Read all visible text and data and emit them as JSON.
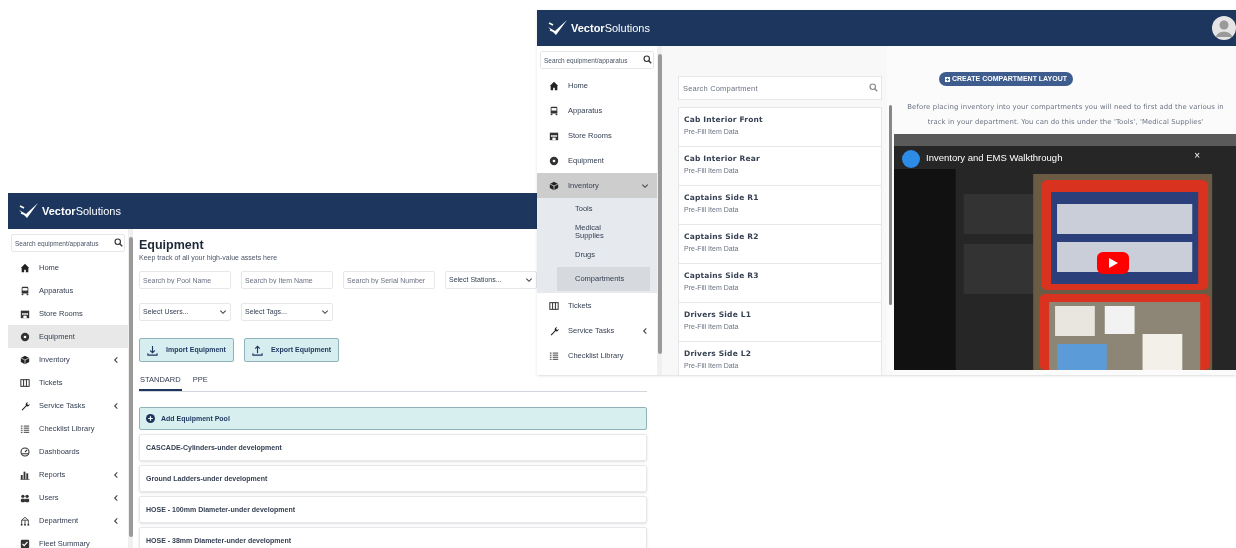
{
  "equipment_window": {
    "logo": {
      "bold": "Vector",
      "light": "Solutions"
    },
    "sidebar": {
      "search_placeholder": "Search equipment/apparatus",
      "items": [
        {
          "label": "Home",
          "kind": "link",
          "selected": false
        },
        {
          "label": "Apparatus",
          "kind": "link",
          "selected": false
        },
        {
          "label": "Store Rooms",
          "kind": "link",
          "selected": false
        },
        {
          "label": "Equipment",
          "kind": "link",
          "selected": true
        },
        {
          "label": "Inventory",
          "kind": "group",
          "selected": false,
          "expanded": false
        },
        {
          "label": "Tickets",
          "kind": "link",
          "selected": false
        },
        {
          "label": "Service Tasks",
          "kind": "group",
          "selected": false,
          "expanded": false
        },
        {
          "label": "Checklist Library",
          "kind": "link",
          "selected": false
        },
        {
          "label": "Dashboards",
          "kind": "link",
          "selected": false
        },
        {
          "label": "Reports",
          "kind": "group",
          "selected": false,
          "expanded": false
        },
        {
          "label": "Users",
          "kind": "group",
          "selected": false,
          "expanded": false
        },
        {
          "label": "Department",
          "kind": "group",
          "selected": false,
          "expanded": false
        },
        {
          "label": "Fleet Summary",
          "kind": "link",
          "selected": false
        }
      ]
    },
    "page": {
      "title": "Equipment",
      "subtitle": "Keep track of all your high-value assets here",
      "filters": [
        {
          "kind": "input",
          "placeholder": "Search by Pool Name"
        },
        {
          "kind": "input",
          "placeholder": "Search by Item Name"
        },
        {
          "kind": "input",
          "placeholder": "Search by Serial Number"
        },
        {
          "kind": "select",
          "placeholder": "Select Stations..."
        },
        {
          "kind": "select",
          "placeholder": "Select Users..."
        },
        {
          "kind": "select",
          "placeholder": "Select Tags..."
        }
      ],
      "actions": [
        {
          "label": "Import Equipment",
          "kind": "import"
        },
        {
          "label": "Export Equipment",
          "kind": "export"
        }
      ],
      "tabs": [
        {
          "label": "STANDARD",
          "selected": true
        },
        {
          "label": "PPE",
          "selected": false
        }
      ],
      "add_button": "Add Equipment Pool",
      "pools": [
        "CASCADE-Cylinders-under development",
        "Ground Ladders-under development",
        "HOSE - 100mm Diameter-under development",
        "HOSE - 38mm Diameter-under development"
      ]
    }
  },
  "compartment_window": {
    "logo": {
      "bold": "Vector",
      "light": "Solutions"
    },
    "sidebar": {
      "search_placeholder": "Search equipment/apparatus",
      "items": [
        {
          "label": "Home",
          "kind": "link",
          "selected": false
        },
        {
          "label": "Apparatus",
          "kind": "link",
          "selected": false
        },
        {
          "label": "Store Rooms",
          "kind": "link",
          "selected": false
        },
        {
          "label": "Equipment",
          "kind": "link",
          "selected": false
        },
        {
          "label": "Inventory",
          "kind": "group",
          "selected": false,
          "expanded": true,
          "children": [
            {
              "label": "Tools",
              "selected": false
            },
            {
              "label": "Medical Supplies",
              "selected": false
            },
            {
              "label": "Drugs",
              "selected": false
            },
            {
              "label": "Compartments",
              "selected": true
            }
          ]
        },
        {
          "label": "Tickets",
          "kind": "link",
          "selected": false
        },
        {
          "label": "Service Tasks",
          "kind": "group",
          "selected": false,
          "expanded": false
        },
        {
          "label": "Checklist Library",
          "kind": "link",
          "selected": false
        }
      ]
    },
    "compartment_search": {
      "placeholder": "Search Compartment"
    },
    "compartments": [
      {
        "name": "Cab Interior Front",
        "subtitle": "Pre-Fill Item Data"
      },
      {
        "name": "Cab Interior Rear",
        "subtitle": "Pre-Fill Item Data"
      },
      {
        "name": "Captains Side R1",
        "subtitle": "Pre-Fill Item Data"
      },
      {
        "name": "Captains Side R2",
        "subtitle": "Pre-Fill Item Data"
      },
      {
        "name": "Captains Side R3",
        "subtitle": "Pre-Fill Item Data"
      },
      {
        "name": "Drivers Side L1",
        "subtitle": "Pre-Fill Item Data"
      },
      {
        "name": "Drivers Side L2",
        "subtitle": "Pre-Fill Item Data"
      }
    ],
    "create_button": "CREATE COMPARTMENT LAYOUT",
    "notice": [
      "Before placing inventory into your compartments you will need to first add the various in",
      "track in your department. You can do this under the 'Tools', 'Medical Supplies'"
    ],
    "video": {
      "title": "Inventory and EMS Walkthrough",
      "close": "×"
    }
  }
}
